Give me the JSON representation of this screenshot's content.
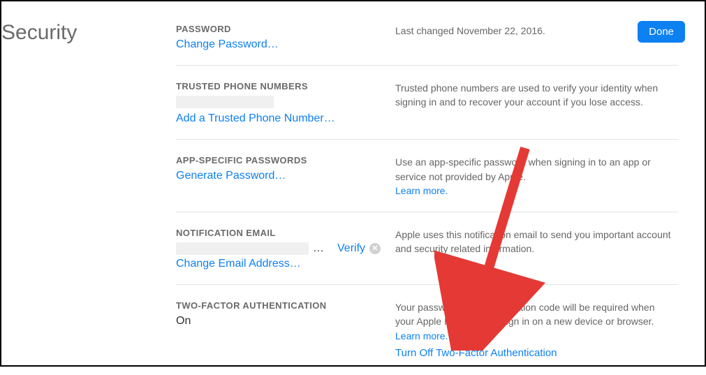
{
  "pageTitle": "Security",
  "doneLabel": "Done",
  "sections": {
    "password": {
      "label": "PASSWORD",
      "changeLink": "Change Password…",
      "info": "Last changed November 22, 2016."
    },
    "trustedPhone": {
      "label": "TRUSTED PHONE NUMBERS",
      "addLink": "Add a Trusted Phone Number…",
      "info": "Trusted phone numbers are used to verify your identity when signing in and to recover your account if you lose access."
    },
    "appPasswords": {
      "label": "APP-SPECIFIC PASSWORDS",
      "generateLink": "Generate Password…",
      "info": "Use an app-specific password when signing in to an app or service not provided by Apple.",
      "learnMore": "Learn more."
    },
    "notificationEmail": {
      "label": "NOTIFICATION EMAIL",
      "dots": "…",
      "verify": "Verify",
      "changeLink": "Change Email Address…",
      "info": "Apple uses this notification email to send you important account and security related information."
    },
    "twoFactor": {
      "label": "TWO-FACTOR AUTHENTICATION",
      "status": "On",
      "info": "Your password and a verification code will be required when your Apple ID is used to sign in on a new device or browser.",
      "learnMore": "Learn more.",
      "turnOffLink": "Turn Off Two-Factor Authentication"
    }
  }
}
